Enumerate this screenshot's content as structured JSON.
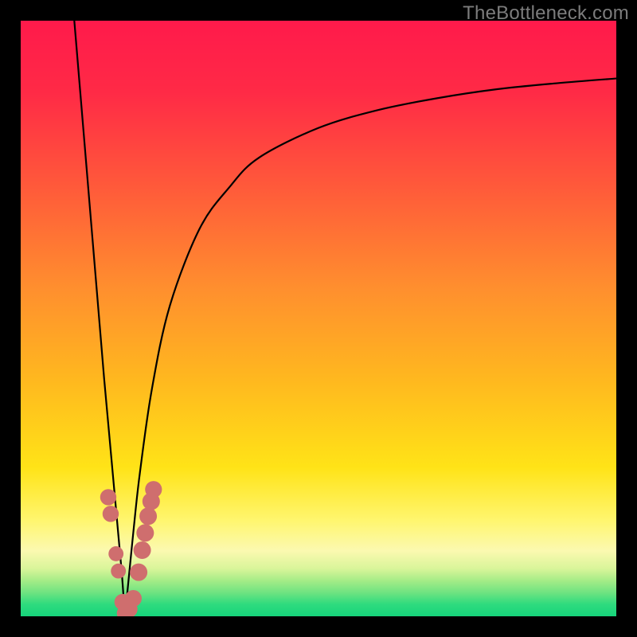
{
  "watermark": "TheBottleneck.com",
  "colors": {
    "frame": "#000000",
    "curve": "#000000",
    "dot_fill": "#cf6e6e",
    "dot_stroke": "#b45a5a"
  },
  "gradient_stops": [
    {
      "pct": 0,
      "color": "#ff1a4b"
    },
    {
      "pct": 12,
      "color": "#ff2a46"
    },
    {
      "pct": 28,
      "color": "#ff5a3a"
    },
    {
      "pct": 45,
      "color": "#ff8f2e"
    },
    {
      "pct": 60,
      "color": "#ffb71f"
    },
    {
      "pct": 75,
      "color": "#ffe317"
    },
    {
      "pct": 84,
      "color": "#fff670"
    },
    {
      "pct": 89,
      "color": "#fbf9b0"
    },
    {
      "pct": 92,
      "color": "#d9f59a"
    },
    {
      "pct": 94,
      "color": "#a5ec87"
    },
    {
      "pct": 96,
      "color": "#6fe381"
    },
    {
      "pct": 98,
      "color": "#2edb7e"
    },
    {
      "pct": 100,
      "color": "#16d47b"
    }
  ],
  "chart_data": {
    "type": "line",
    "title": "",
    "xlabel": "",
    "ylabel": "",
    "xlim": [
      0,
      100
    ],
    "ylim": [
      0,
      100
    ],
    "note": "Bottleneck-style curve. y=0 at the notch minimum (~x=17.5); y rises steeply on both sides. Values estimated from pixel positions; chart has no numeric axes.",
    "series": [
      {
        "name": "curve-left",
        "x": [
          9.0,
          10.0,
          11.0,
          12.0,
          13.0,
          14.0,
          15.0,
          16.0,
          17.0,
          17.5
        ],
        "y": [
          100,
          88,
          76,
          64,
          52,
          40,
          29,
          18,
          7,
          0
        ]
      },
      {
        "name": "curve-right",
        "x": [
          17.5,
          18.0,
          19.0,
          20.0,
          22.0,
          25.0,
          30.0,
          35.0,
          40.0,
          50.0,
          60.0,
          70.0,
          80.0,
          90.0,
          100.0
        ],
        "y": [
          0,
          5,
          15,
          24,
          38,
          52,
          65,
          72,
          77,
          82,
          85,
          87,
          88.5,
          89.5,
          90.3
        ]
      }
    ],
    "dots_left": [
      {
        "x": 14.7,
        "y": 20.0,
        "r": 1.3
      },
      {
        "x": 15.1,
        "y": 17.2,
        "r": 1.3
      },
      {
        "x": 16.0,
        "y": 10.5,
        "r": 1.1
      },
      {
        "x": 16.4,
        "y": 7.6,
        "r": 1.1
      },
      {
        "x": 17.1,
        "y": 2.4,
        "r": 1.3
      },
      {
        "x": 17.5,
        "y": 0.5,
        "r": 1.3
      }
    ],
    "dots_right": [
      {
        "x": 18.2,
        "y": 1.2,
        "r": 1.4
      },
      {
        "x": 18.9,
        "y": 3.0,
        "r": 1.4
      },
      {
        "x": 19.8,
        "y": 7.4,
        "r": 1.5
      },
      {
        "x": 20.4,
        "y": 11.1,
        "r": 1.5
      },
      {
        "x": 20.9,
        "y": 14.0,
        "r": 1.5
      },
      {
        "x": 21.4,
        "y": 16.8,
        "r": 1.5
      },
      {
        "x": 21.9,
        "y": 19.3,
        "r": 1.5
      },
      {
        "x": 22.3,
        "y": 21.3,
        "r": 1.4
      }
    ]
  }
}
